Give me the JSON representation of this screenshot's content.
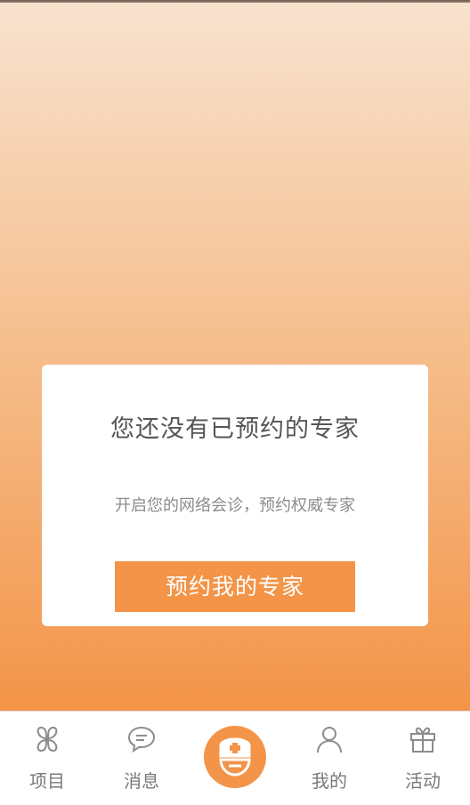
{
  "colors": {
    "accent": "#f39448",
    "gradient_top": "#f8e2cf",
    "gradient_bottom": "#f39448"
  },
  "empty_state": {
    "title": "您还没有已预约的专家",
    "subtitle": "开启您的网络会诊，预约权威专家",
    "button_label": "预约我的专家"
  },
  "tabbar": {
    "items": [
      {
        "label": "项目",
        "icon": "clover-icon"
      },
      {
        "label": "消息",
        "icon": "chat-bubble-icon"
      },
      {
        "label": "",
        "icon": "nurse-cap-icon"
      },
      {
        "label": "我的",
        "icon": "person-icon"
      },
      {
        "label": "活动",
        "icon": "gift-icon"
      }
    ]
  }
}
